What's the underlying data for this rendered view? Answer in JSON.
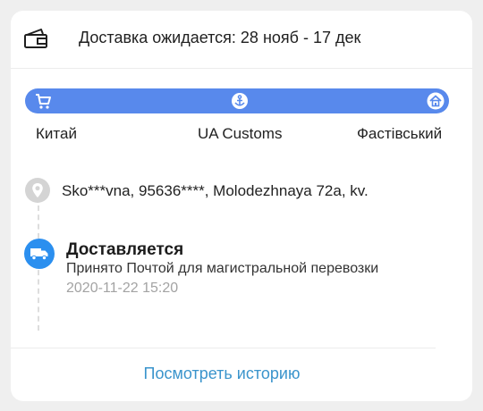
{
  "delivery": {
    "estimate_text": "Доставка ожидается: 28 нояб - 17 дек"
  },
  "route": {
    "progress": 1.0,
    "stages": [
      {
        "label": "Китай",
        "icon": "cart-icon"
      },
      {
        "label": "UA Customs",
        "icon": "anchor-icon"
      },
      {
        "label": "Фастівський",
        "icon": "home-icon"
      }
    ]
  },
  "address": {
    "text": "Sko***vna,  95636****,  Molodezhnaya 72a, kv."
  },
  "latest_event": {
    "title": "Доставляется",
    "description": "Принято Почтой для магистральной перевозки",
    "timestamp": "2020-11-22 15:20",
    "icon": "truck-icon"
  },
  "history_link": {
    "label": "Посмотреть историю"
  },
  "colors": {
    "progress_bar": "#5889ec",
    "status_dot": "#2b8fef",
    "link": "#3a94cc",
    "pin": "#d4d4d4"
  }
}
